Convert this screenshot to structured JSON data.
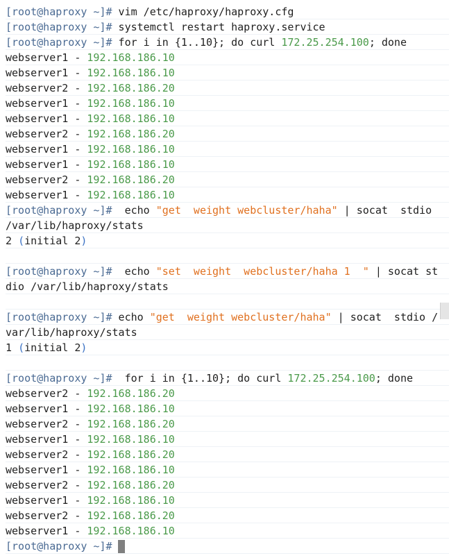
{
  "prompt": "[root@haproxy ~]#",
  "lines": [
    {
      "segs": [
        {
          "t": "[root@haproxy ~]#",
          "c": "prompt"
        },
        {
          "t": " vim /etc/haproxy/haproxy.cfg",
          "c": ""
        }
      ]
    },
    {
      "segs": [
        {
          "t": "[root@haproxy ~]#",
          "c": "prompt"
        },
        {
          "t": " systemctl restart haproxy.service",
          "c": ""
        }
      ]
    },
    {
      "segs": [
        {
          "t": "[root@haproxy ~]#",
          "c": "prompt"
        },
        {
          "t": " for i in {1..10}; do curl ",
          "c": ""
        },
        {
          "t": "172.25.254.100",
          "c": "ip"
        },
        {
          "t": "; done",
          "c": ""
        }
      ]
    },
    {
      "segs": [
        {
          "t": "webserver1 - ",
          "c": ""
        },
        {
          "t": "192.168.186.10",
          "c": "ip"
        }
      ]
    },
    {
      "segs": [
        {
          "t": "webserver1 - ",
          "c": ""
        },
        {
          "t": "192.168.186.10",
          "c": "ip"
        }
      ]
    },
    {
      "segs": [
        {
          "t": "webserver2 - ",
          "c": ""
        },
        {
          "t": "192.168.186.20",
          "c": "ip"
        }
      ]
    },
    {
      "segs": [
        {
          "t": "webserver1 - ",
          "c": ""
        },
        {
          "t": "192.168.186.10",
          "c": "ip"
        }
      ]
    },
    {
      "segs": [
        {
          "t": "webserver1 - ",
          "c": ""
        },
        {
          "t": "192.168.186.10",
          "c": "ip"
        }
      ]
    },
    {
      "segs": [
        {
          "t": "webserver2 - ",
          "c": ""
        },
        {
          "t": "192.168.186.20",
          "c": "ip"
        }
      ]
    },
    {
      "segs": [
        {
          "t": "webserver1 - ",
          "c": ""
        },
        {
          "t": "192.168.186.10",
          "c": "ip"
        }
      ]
    },
    {
      "segs": [
        {
          "t": "webserver1 - ",
          "c": ""
        },
        {
          "t": "192.168.186.10",
          "c": "ip"
        }
      ]
    },
    {
      "segs": [
        {
          "t": "webserver2 - ",
          "c": ""
        },
        {
          "t": "192.168.186.20",
          "c": "ip"
        }
      ]
    },
    {
      "segs": [
        {
          "t": "webserver1 - ",
          "c": ""
        },
        {
          "t": "192.168.186.10",
          "c": "ip"
        }
      ]
    },
    {
      "segs": [
        {
          "t": "[root@haproxy ~]#",
          "c": "prompt"
        },
        {
          "t": "  echo ",
          "c": ""
        },
        {
          "t": "\"get  weight webcluster/haha\"",
          "c": "str"
        },
        {
          "t": " | socat  stdio",
          "c": ""
        }
      ]
    },
    {
      "segs": [
        {
          "t": "/var/lib/haproxy/stats",
          "c": ""
        }
      ]
    },
    {
      "segs": [
        {
          "t": "2 ",
          "c": ""
        },
        {
          "t": "(",
          "c": "paren"
        },
        {
          "t": "initial 2",
          "c": ""
        },
        {
          "t": ")",
          "c": "paren"
        }
      ]
    },
    {
      "segs": []
    },
    {
      "segs": [
        {
          "t": "[root@haproxy ~]#",
          "c": "prompt"
        },
        {
          "t": "  echo ",
          "c": ""
        },
        {
          "t": "\"set  weight  webcluster/haha 1  \"",
          "c": "str"
        },
        {
          "t": " | socat st",
          "c": ""
        }
      ]
    },
    {
      "segs": [
        {
          "t": "dio /var/lib/haproxy/stats",
          "c": ""
        }
      ]
    },
    {
      "segs": []
    },
    {
      "segs": [
        {
          "t": "[root@haproxy ~]#",
          "c": "prompt"
        },
        {
          "t": " echo ",
          "c": ""
        },
        {
          "t": "\"get  weight webcluster/haha\"",
          "c": "str"
        },
        {
          "t": " | socat  stdio /",
          "c": ""
        }
      ]
    },
    {
      "segs": [
        {
          "t": "var/lib/haproxy/stats",
          "c": ""
        }
      ]
    },
    {
      "segs": [
        {
          "t": "1 ",
          "c": ""
        },
        {
          "t": "(",
          "c": "paren"
        },
        {
          "t": "initial 2",
          "c": ""
        },
        {
          "t": ")",
          "c": "paren"
        }
      ]
    },
    {
      "segs": []
    },
    {
      "segs": [
        {
          "t": "[root@haproxy ~]#",
          "c": "prompt"
        },
        {
          "t": "  for i in {1..10}; do curl ",
          "c": ""
        },
        {
          "t": "172.25.254.100",
          "c": "ip"
        },
        {
          "t": "; done",
          "c": ""
        }
      ]
    },
    {
      "segs": [
        {
          "t": "webserver2 - ",
          "c": ""
        },
        {
          "t": "192.168.186.20",
          "c": "ip"
        }
      ]
    },
    {
      "segs": [
        {
          "t": "webserver1 - ",
          "c": ""
        },
        {
          "t": "192.168.186.10",
          "c": "ip"
        }
      ]
    },
    {
      "segs": [
        {
          "t": "webserver2 - ",
          "c": ""
        },
        {
          "t": "192.168.186.20",
          "c": "ip"
        }
      ]
    },
    {
      "segs": [
        {
          "t": "webserver1 - ",
          "c": ""
        },
        {
          "t": "192.168.186.10",
          "c": "ip"
        }
      ]
    },
    {
      "segs": [
        {
          "t": "webserver2 - ",
          "c": ""
        },
        {
          "t": "192.168.186.20",
          "c": "ip"
        }
      ]
    },
    {
      "segs": [
        {
          "t": "webserver1 - ",
          "c": ""
        },
        {
          "t": "192.168.186.10",
          "c": "ip"
        }
      ]
    },
    {
      "segs": [
        {
          "t": "webserver2 - ",
          "c": ""
        },
        {
          "t": "192.168.186.20",
          "c": "ip"
        }
      ]
    },
    {
      "segs": [
        {
          "t": "webserver1 - ",
          "c": ""
        },
        {
          "t": "192.168.186.10",
          "c": "ip"
        }
      ]
    },
    {
      "segs": [
        {
          "t": "webserver2 - ",
          "c": ""
        },
        {
          "t": "192.168.186.20",
          "c": "ip"
        }
      ]
    },
    {
      "segs": [
        {
          "t": "webserver1 - ",
          "c": ""
        },
        {
          "t": "192.168.186.10",
          "c": "ip"
        }
      ]
    }
  ],
  "colors": {
    "prompt": "#4a6a93",
    "ip": "#4a9a4a",
    "string": "#e0701f",
    "paren": "#3b72c4"
  }
}
